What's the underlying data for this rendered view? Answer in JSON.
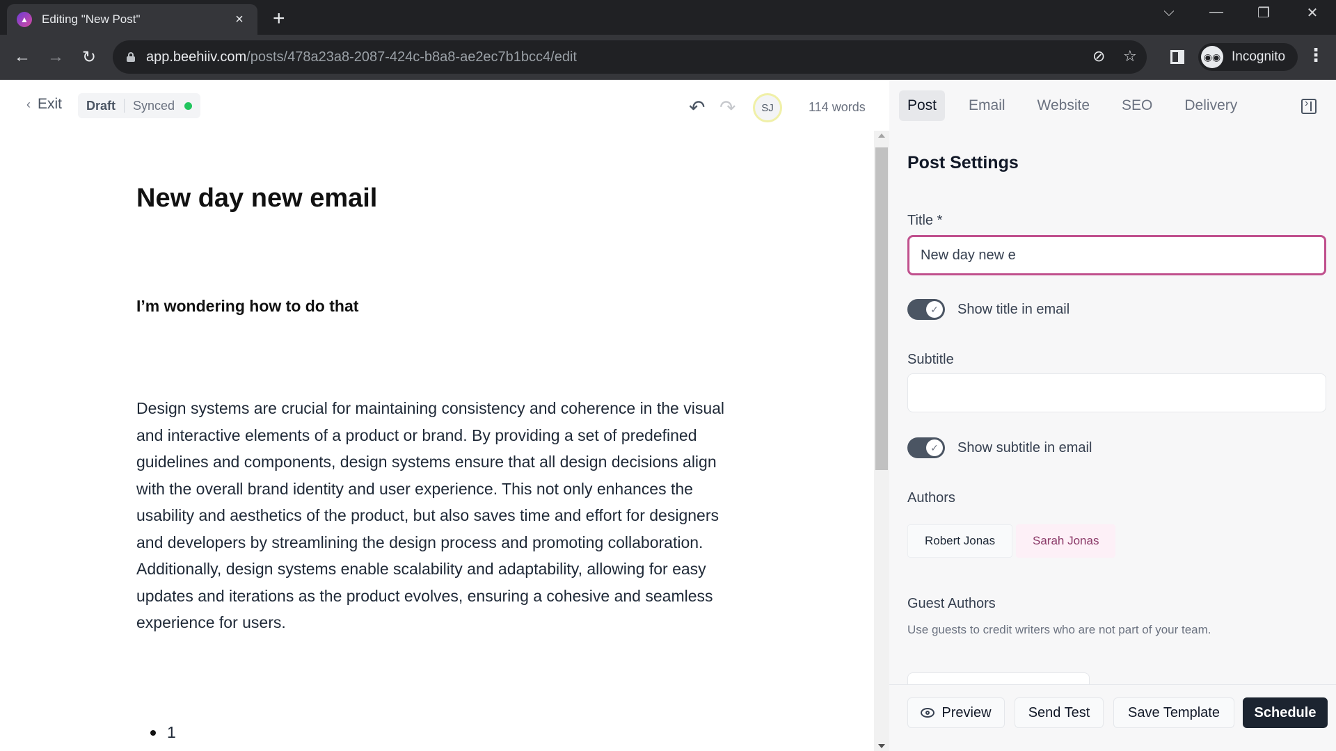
{
  "browser": {
    "tab_title": "Editing \"New Post\"",
    "url_host": "app.beehiiv.com",
    "url_path": "/posts/478a23a8-2087-424c-b8a8-ae2ec7b1bcc4/edit",
    "profile_label": "Incognito",
    "icons": {
      "favicon": "beehiiv-favicon",
      "close": "×",
      "new_tab": "+",
      "tab_search": "⌵",
      "minimize": "—",
      "restore": "❐",
      "close_window": "✕",
      "back": "←",
      "forward": "→",
      "reload": "↻",
      "eye_off": "◎̸",
      "star": "☆",
      "incognito": "🕶",
      "menu": "⋮"
    }
  },
  "editor": {
    "exit_label": "Exit",
    "status_draft": "Draft",
    "status_synced": "Synced",
    "sync_color": "#22c55e",
    "collaborator_initials": "SJ",
    "word_count": "114 words",
    "undo_icon": "↶",
    "redo_icon": "↷",
    "document": {
      "title": "New day new email",
      "subheading": "I’m wondering how to do that",
      "paragraph": "Design systems are crucial for maintaining consistency and coherence in the visual and interactive elements of a product or brand. By providing a set of predefined guidelines and components, design systems ensure that all design decisions align with the overall brand identity and user experience. This not only enhances the usability and aesthetics of the product, but also saves time and effort for designers and developers by streamlining the design process and promoting collaboration. Additionally, design systems enable scalability and adaptability, allowing for easy updates and iterations as the product evolves, ensuring a cohesive and seamless experience for users.",
      "list_items": [
        "1"
      ]
    }
  },
  "sidebar": {
    "tabs": [
      {
        "label": "Post",
        "active": true
      },
      {
        "label": "Email",
        "active": false
      },
      {
        "label": "Website",
        "active": false
      },
      {
        "label": "SEO",
        "active": false
      },
      {
        "label": "Delivery",
        "active": false
      }
    ],
    "heading": "Post Settings",
    "title_label": "Title *",
    "title_value": "New day new e",
    "show_title_label": "Show title in email",
    "show_title_on": true,
    "subtitle_label": "Subtitle",
    "subtitle_value": "",
    "show_subtitle_label": "Show subtitle in email",
    "show_subtitle_on": true,
    "authors_label": "Authors",
    "authors": [
      {
        "name": "Robert Jonas",
        "selected": false
      },
      {
        "name": "Sarah Jonas",
        "selected": true
      }
    ],
    "guest_authors_label": "Guest Authors",
    "guest_authors_help": "Use guests to credit writers who are not part of your team.",
    "accent_color": "#c0508d",
    "footer": {
      "preview": "Preview",
      "send_test": "Send Test",
      "save_template": "Save Template",
      "schedule": "Schedule"
    }
  }
}
